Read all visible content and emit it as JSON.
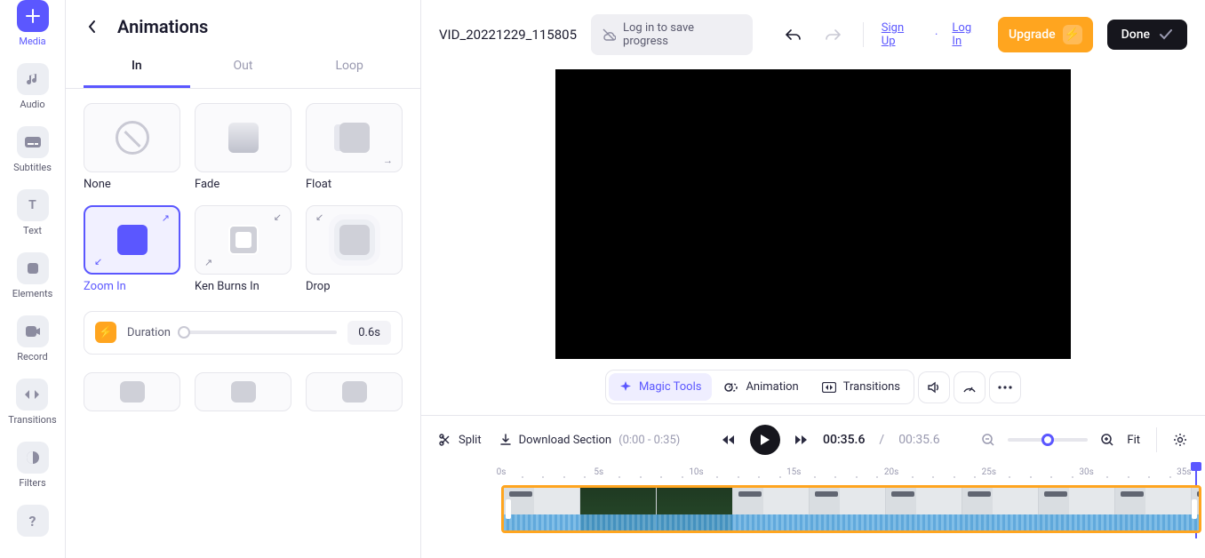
{
  "rail": {
    "items": [
      {
        "label": "Media",
        "icon": "plus"
      },
      {
        "label": "Audio",
        "icon": "note"
      },
      {
        "label": "Subtitles",
        "icon": "cc"
      },
      {
        "label": "Text",
        "icon": "T"
      },
      {
        "label": "Elements",
        "icon": "shape"
      },
      {
        "label": "Record",
        "icon": "rec"
      },
      {
        "label": "Transitions",
        "icon": "trans"
      },
      {
        "label": "Filters",
        "icon": "filt"
      },
      {
        "label": "",
        "icon": "help"
      }
    ],
    "active_index": 0
  },
  "panel": {
    "title": "Animations",
    "tabs": [
      "In",
      "Out",
      "Loop"
    ],
    "active_tab": 0,
    "animations_row1": [
      {
        "label": "None"
      },
      {
        "label": "Fade"
      },
      {
        "label": "Float"
      }
    ],
    "animations_row2": [
      {
        "label": "Zoom In",
        "selected": true
      },
      {
        "label": "Ken Burns In"
      },
      {
        "label": "Drop"
      }
    ],
    "duration_label": "Duration",
    "duration_value": "0.6s"
  },
  "topbar": {
    "project_name": "VID_20221229_115805",
    "login_prompt": "Log in to save progress",
    "signup": "Sign Up",
    "login": "Log In",
    "upgrade": "Upgrade",
    "done": "Done"
  },
  "toolrow": {
    "magic": "Magic Tools",
    "animation": "Animation",
    "transitions": "Transitions"
  },
  "tlcontrols": {
    "split": "Split",
    "download": "Download Section",
    "download_range": "(0:00 - 0:35)",
    "current": "00:35.6",
    "total": "00:35.6",
    "fit": "Fit"
  },
  "ruler": {
    "marks": [
      "0s",
      "5s",
      "10s",
      "15s",
      "20s",
      "25s",
      "30s",
      "35s"
    ]
  }
}
